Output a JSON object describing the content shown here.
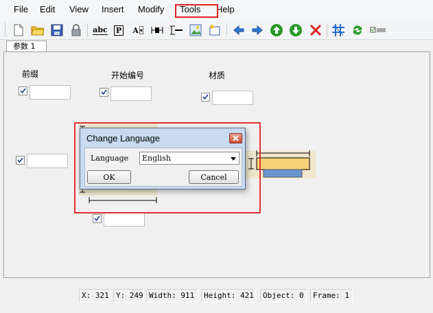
{
  "menu": {
    "file": "File",
    "edit": "Edit",
    "view": "View",
    "insert": "Insert",
    "modify": "Modify",
    "tools": "Tools",
    "help": "Help"
  },
  "toolbar": {
    "icons": [
      "new-file-icon",
      "open-folder-icon",
      "save-icon",
      "lock-icon",
      "abc-text-icon",
      "p-text-icon",
      "a-dropdown-icon",
      "horizontal-dim-icon",
      "vertical-dim-icon",
      "image-icon",
      "frame-icon",
      "arrow-left-icon",
      "arrow-right-icon",
      "arrow-up-icon",
      "arrow-down-icon",
      "delete-icon",
      "grid-icon",
      "refresh-icon",
      "toggle-icon"
    ],
    "text_abc": "abc",
    "text_p": "P",
    "text_a": "A"
  },
  "tab": {
    "label": "参数 1"
  },
  "params": {
    "prefix_label": "前缀",
    "start_number_label": "开始编号",
    "material_label": "材质"
  },
  "dialog": {
    "title": "Change Language",
    "language_label": "Language",
    "language_value": "English",
    "ok_label": "OK",
    "cancel_label": "Cancel"
  },
  "status": {
    "x": "X: 321",
    "y": "Y: 249",
    "width": "Width: 911",
    "height": "Height: 421",
    "object": "Object: 0",
    "frame": "Frame: 1"
  },
  "colors": {
    "highlight": "#e02020",
    "dim_fill": "#f8d27a",
    "base_fill": "#6a95d0"
  }
}
